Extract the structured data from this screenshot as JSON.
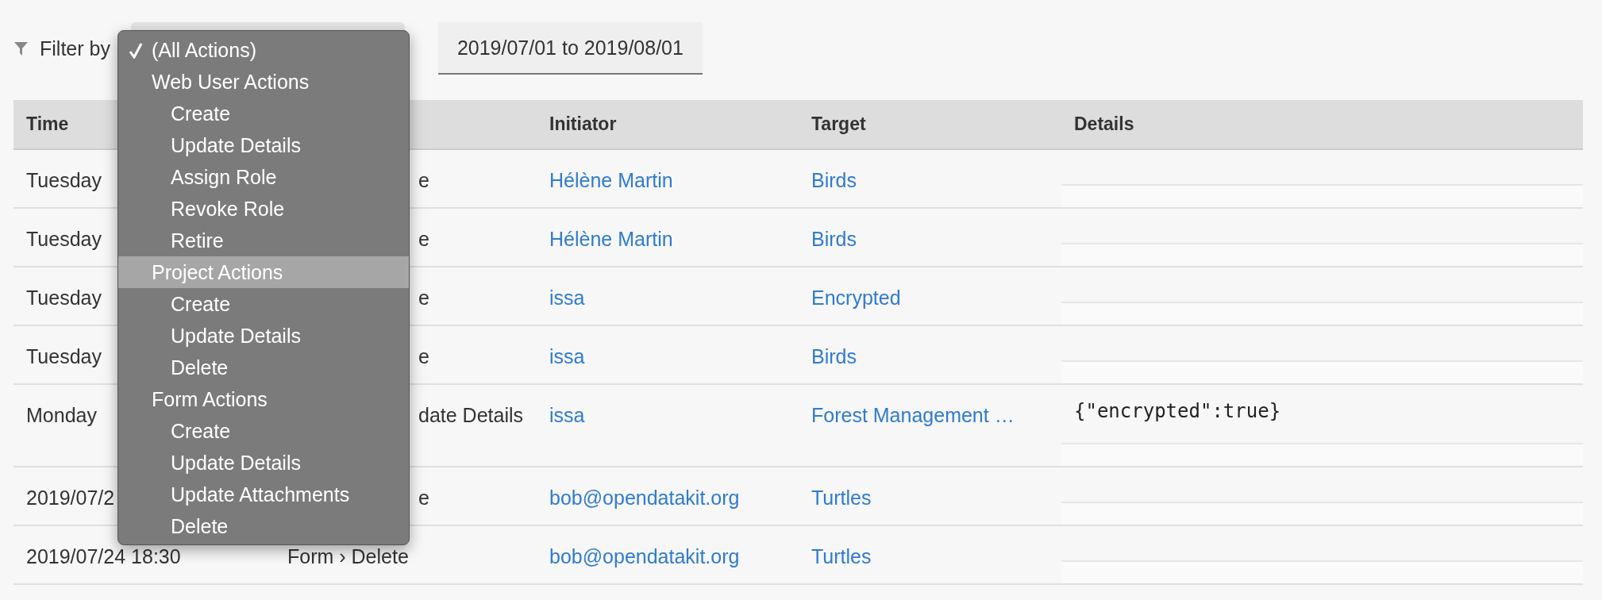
{
  "filter": {
    "label": "Filter by",
    "date_range": "2019/07/01 to 2019/08/01"
  },
  "dropdown": {
    "items": [
      {
        "label": "(All Actions)",
        "selected": true,
        "highlighted": false
      },
      {
        "label": "Web User Actions",
        "selected": false,
        "highlighted": false,
        "children": [
          {
            "label": "Create",
            "selected": false,
            "highlighted": false
          },
          {
            "label": "Update Details",
            "selected": false,
            "highlighted": false
          },
          {
            "label": "Assign Role",
            "selected": false,
            "highlighted": false
          },
          {
            "label": "Revoke Role",
            "selected": false,
            "highlighted": false
          },
          {
            "label": "Retire",
            "selected": false,
            "highlighted": false
          }
        ]
      },
      {
        "label": "Project Actions",
        "selected": false,
        "highlighted": true,
        "children": [
          {
            "label": "Create",
            "selected": false,
            "highlighted": false
          },
          {
            "label": "Update Details",
            "selected": false,
            "highlighted": false
          },
          {
            "label": "Delete",
            "selected": false,
            "highlighted": false
          }
        ]
      },
      {
        "label": "Form Actions",
        "selected": false,
        "highlighted": false,
        "children": [
          {
            "label": "Create",
            "selected": false,
            "highlighted": false
          },
          {
            "label": "Update Details",
            "selected": false,
            "highlighted": false
          },
          {
            "label": "Update Attachments",
            "selected": false,
            "highlighted": false
          },
          {
            "label": "Delete",
            "selected": false,
            "highlighted": false
          }
        ]
      }
    ]
  },
  "table": {
    "columns": [
      "Time",
      "Initiator",
      "Target",
      "Details"
    ],
    "rows": [
      {
        "time": "Tuesday",
        "type": {
          "text": "e",
          "clipped": true
        },
        "initiator": "Hélène Martin",
        "target": "Birds"
      },
      {
        "time": "Tuesday",
        "type": {
          "text": "e",
          "clipped": true
        },
        "initiator": "Hélène Martin",
        "target": "Birds"
      },
      {
        "time": "Tuesday",
        "type": {
          "text": "e",
          "clipped": true
        },
        "initiator": "issa",
        "target": "Encrypted"
      },
      {
        "time": "Tuesday",
        "type": {
          "text": "e",
          "clipped": true
        },
        "initiator": "issa",
        "target": "Birds"
      },
      {
        "time": "Monday",
        "type": {
          "text": "date Details",
          "clipped": true
        },
        "initiator": "issa",
        "target": "Forest Management …",
        "details": "{\"encrypted\":true}"
      },
      {
        "time": "2019/07/2",
        "type": {
          "text": "e",
          "clipped": true
        },
        "initiator": "bob@opendatakit.org",
        "target": "Turtles"
      },
      {
        "time": "2019/07/24 18:30",
        "type": {
          "text": "Form › Delete",
          "clipped": false
        },
        "initiator": "bob@opendatakit.org",
        "target": "Turtles"
      }
    ]
  }
}
